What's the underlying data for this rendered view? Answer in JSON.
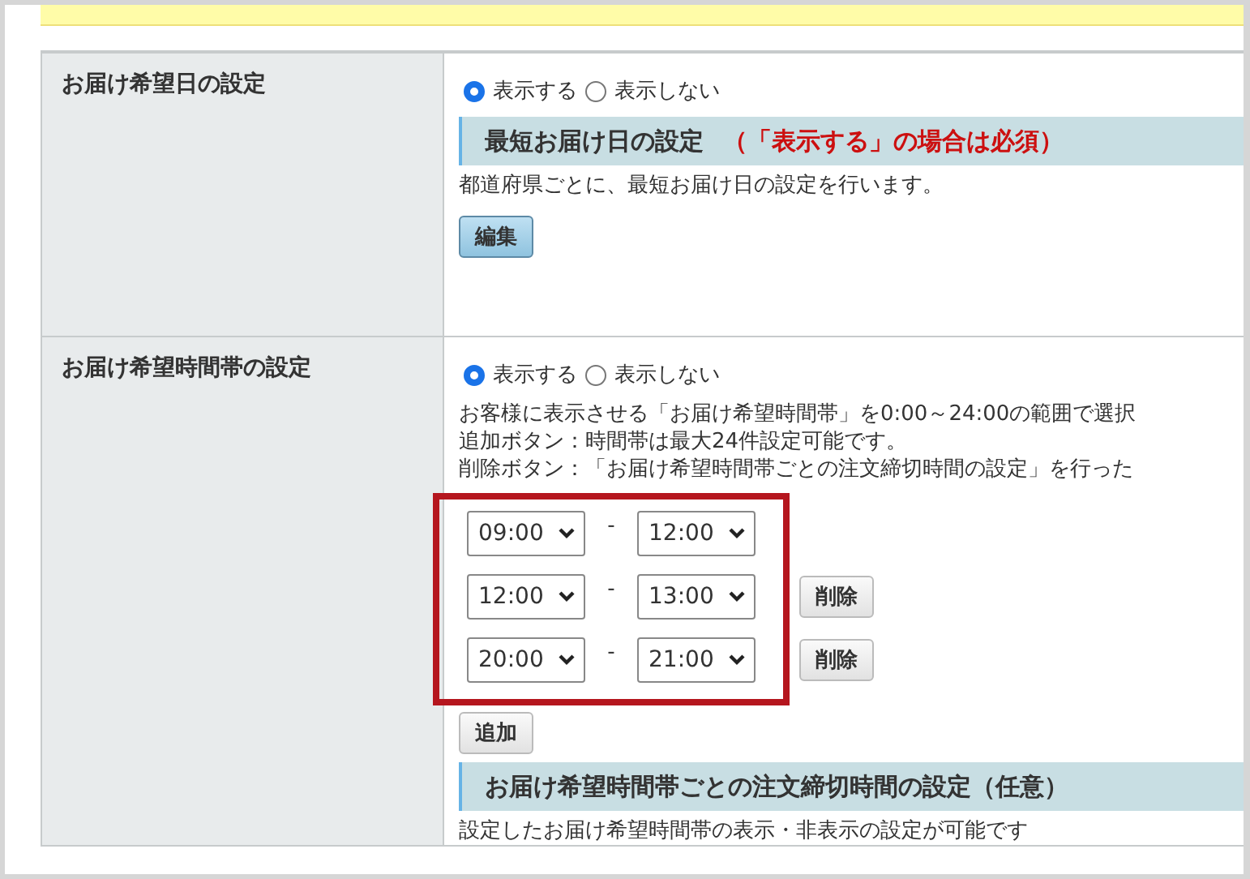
{
  "rows": [
    {
      "label": "お届け希望日の設定",
      "options": [
        {
          "label": "表示する",
          "selected": true
        },
        {
          "label": "表示しない",
          "selected": false
        }
      ],
      "content": [
        {
          "kind": "heading",
          "text": "最短お届け日の設定",
          "note": "（「表示する」の場合は必須）"
        },
        {
          "kind": "text",
          "lines": [
            "都道府県ごとに、最短お届け日の設定を行います。"
          ]
        },
        {
          "kind": "primary",
          "label": "編集"
        }
      ]
    },
    {
      "label": "お届け希望時間帯の設定",
      "options": [
        {
          "label": "表示する",
          "selected": true
        },
        {
          "label": "表示しない",
          "selected": false
        }
      ],
      "content": [
        {
          "kind": "text",
          "lines": [
            "お客様に表示させる「お届け希望時間帯」を0:00～24:00の範囲で選択",
            "追加ボタン：時間帯は最大24件設定可能です。",
            "削除ボタン：「お届け希望時間帯ごとの注文締切時間の設定」を行った"
          ]
        },
        {
          "kind": "time_slots",
          "highlighted": true,
          "slots": [
            {
              "from": "09:00",
              "separator": "-",
              "to": "12:00"
            },
            {
              "from": "12:00",
              "separator": "-",
              "to": "13:00",
              "delete_label": "削除"
            },
            {
              "from": "20:00",
              "separator": "-",
              "to": "21:00",
              "delete_label": "削除"
            }
          ]
        },
        {
          "kind": "button",
          "label": "追加"
        },
        {
          "kind": "heading",
          "text": "お届け希望時間帯ごとの注文締切時間の設定（任意）"
        },
        {
          "kind": "text",
          "lines": [
            "設定したお届け希望時間帯の表示・非表示の設定が可能です"
          ]
        }
      ]
    }
  ]
}
